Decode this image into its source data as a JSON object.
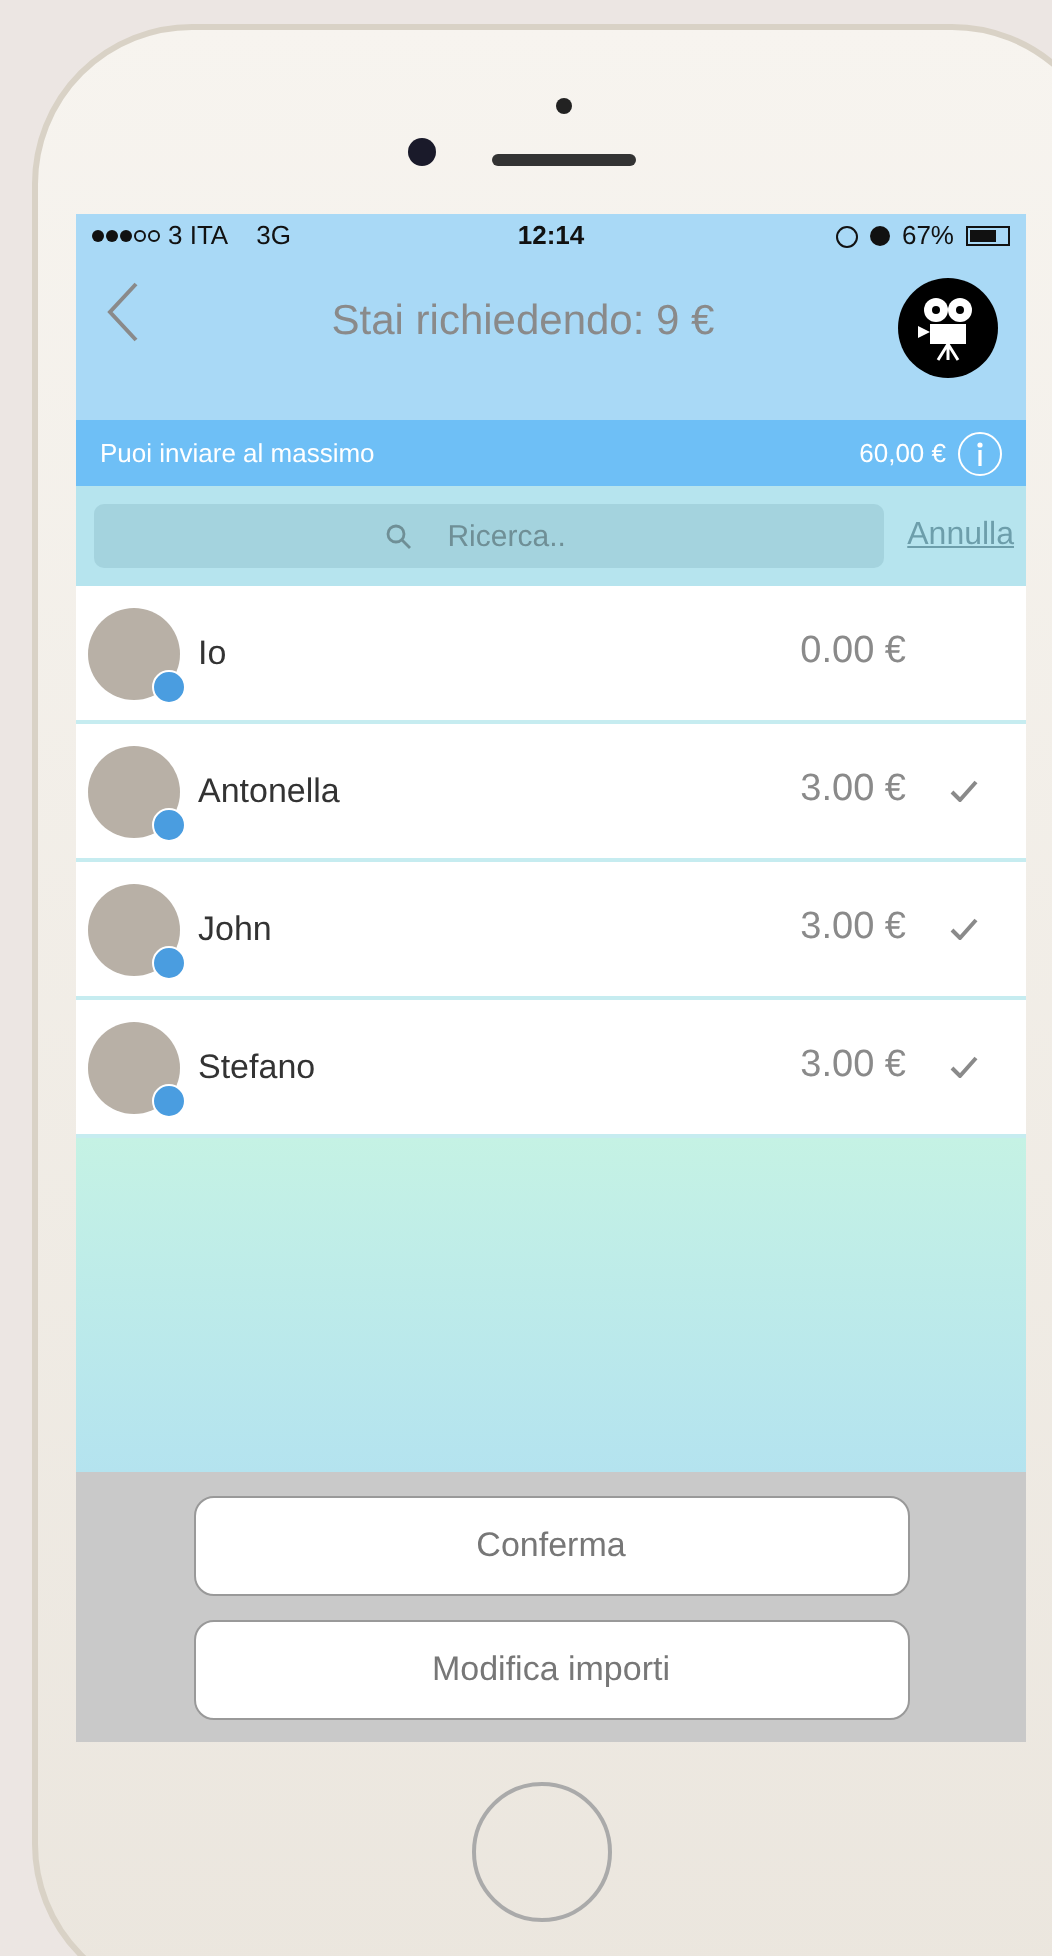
{
  "status_bar": {
    "carrier": "3 ITA",
    "network": "3G",
    "time": "12:14",
    "battery": "67%"
  },
  "nav": {
    "title": "Stai richiedendo: 9 €"
  },
  "info_bar": {
    "label": "Puoi inviare al massimo",
    "amount": "60,00 €"
  },
  "search": {
    "placeholder": "Ricerca..",
    "cancel": "Annulla"
  },
  "contacts": [
    {
      "name": "Io",
      "amount": "0.00 €",
      "selected": false
    },
    {
      "name": "Antonella",
      "amount": "3.00 €",
      "selected": true
    },
    {
      "name": "John",
      "amount": "3.00 €",
      "selected": true
    },
    {
      "name": "Stefano",
      "amount": "3.00 €",
      "selected": true
    }
  ],
  "buttons": [
    "Conferma",
    "Modifica importi"
  ]
}
